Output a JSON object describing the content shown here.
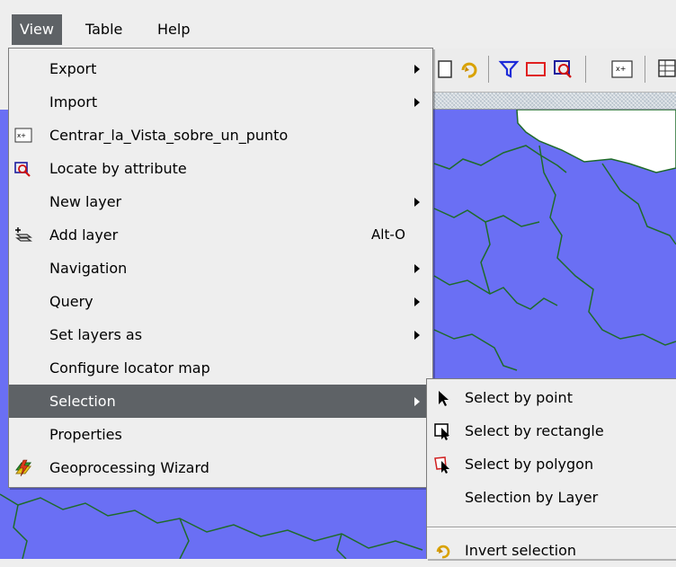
{
  "menubar": {
    "items": [
      {
        "label": "View"
      },
      {
        "label": "Table"
      },
      {
        "label": "Help"
      }
    ]
  },
  "view_menu": {
    "items": [
      {
        "label": "Export",
        "icon": "",
        "submenu": true
      },
      {
        "label": "Import",
        "icon": "",
        "submenu": true
      },
      {
        "label": "Centrar_la_Vista_sobre_un_punto",
        "icon": "center-view-icon",
        "submenu": false
      },
      {
        "label": "Locate by attribute",
        "icon": "locate-by-attribute-icon",
        "submenu": false
      },
      {
        "label": "New layer",
        "icon": "",
        "submenu": true
      },
      {
        "label": "Add layer",
        "icon": "add-layer-icon",
        "accelerator": "Alt-O",
        "submenu": false
      },
      {
        "label": "Navigation",
        "icon": "",
        "submenu": true
      },
      {
        "label": "Query",
        "icon": "",
        "submenu": true
      },
      {
        "label": "Set layers as",
        "icon": "",
        "submenu": true
      },
      {
        "label": "Configure locator map",
        "icon": "",
        "submenu": false
      },
      {
        "label": "Selection",
        "icon": "",
        "submenu": true,
        "highlighted": true
      },
      {
        "label": "Properties",
        "icon": "",
        "submenu": false
      },
      {
        "label": "Geoprocessing Wizard",
        "icon": "geoprocessing-icon",
        "submenu": false
      }
    ]
  },
  "selection_submenu": {
    "items": [
      {
        "label": "Select by point",
        "icon": "select-point-icon"
      },
      {
        "label": "Select by rectangle",
        "icon": "select-rectangle-icon"
      },
      {
        "label": "Select by polygon",
        "icon": "select-polygon-icon"
      },
      {
        "label": "Selection by Layer",
        "icon": ""
      },
      {
        "label": "Invert selection",
        "icon": "invert-selection-icon"
      }
    ]
  },
  "toolbar": {
    "icons": [
      "blank-page-icon",
      "invert-selection-icon",
      "filter-icon",
      "select-rectangle-icon",
      "locate-by-attribute-icon",
      "center-view-icon",
      "table-icon"
    ]
  },
  "colors": {
    "menu_bg": "#eeeeee",
    "highlight": "#5e6266",
    "map_fill": "#6a6ff4",
    "boundary": "#1f6b2a"
  }
}
